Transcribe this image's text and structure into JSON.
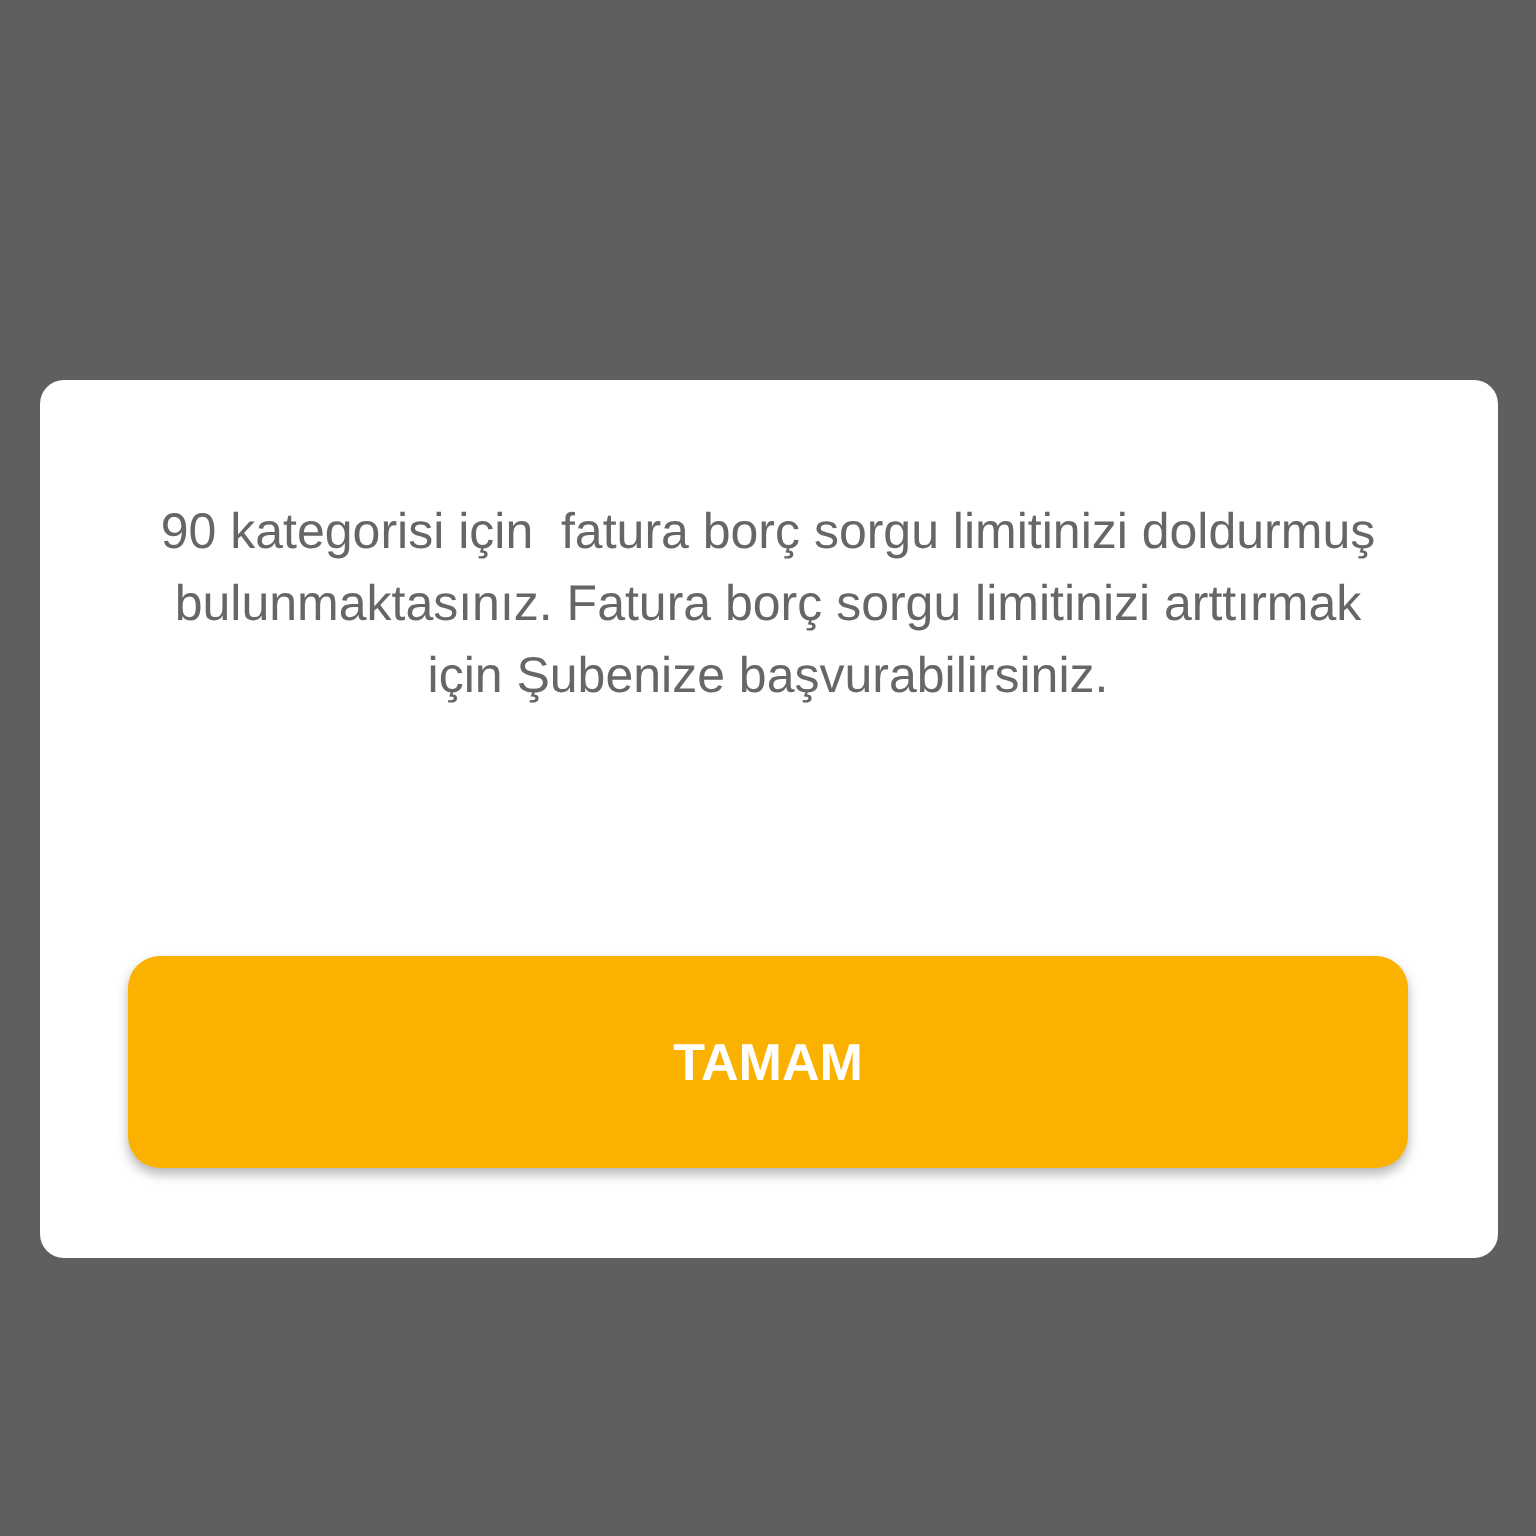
{
  "dialog": {
    "message": "90 kategorisi için  fatura borç sorgu limitinizi doldurmuş bulunmaktasınız. Fatura borç sorgu limitinizi arttırmak için Şubenize başvurabilirsiniz.",
    "buttons": [
      "TAMAM"
    ]
  }
}
